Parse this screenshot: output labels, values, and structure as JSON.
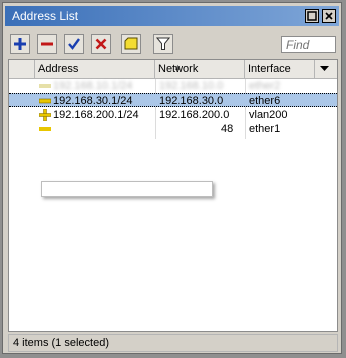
{
  "window": {
    "title": "Address List"
  },
  "toolbar": {
    "find_placeholder": "Find",
    "buttons": [
      "add-icon",
      "remove-icon",
      "enable-check-icon",
      "disable-x-icon",
      "comment-icon",
      "filter-icon"
    ]
  },
  "table": {
    "columns": [
      "Address",
      "Network",
      "Interface"
    ],
    "rows": [
      {
        "address": "192.168.10.1/24",
        "network": "192.168.10.0",
        "interface": "ether2",
        "state": "blurred"
      },
      {
        "address": "192.168.30.1/24",
        "network": "192.168.30.0",
        "interface": "ether6",
        "state": "selected"
      },
      {
        "address": "192.168.200.1/24",
        "network": "192.168.200.0",
        "interface": "vlan200",
        "state": "normal"
      },
      {
        "address": "",
        "network": "48",
        "interface": "ether1",
        "state": "partial"
      }
    ]
  },
  "status": {
    "text": "4 items (1 selected)"
  },
  "colors": {
    "titlebar": "#3a6fb8",
    "selection": "#abc7e8",
    "address_icon": "#e8c600"
  }
}
